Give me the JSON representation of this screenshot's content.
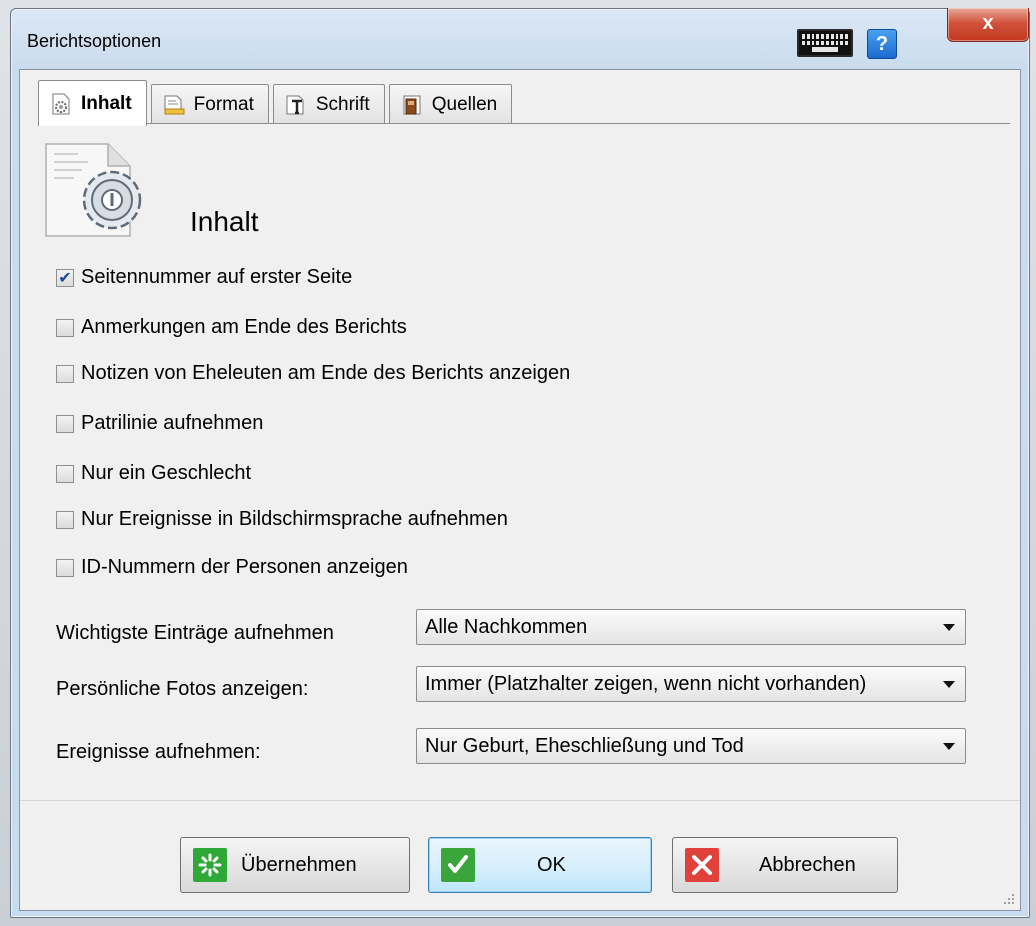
{
  "window": {
    "title": "Berichtsoptionen",
    "close_label": "x",
    "help_label": "?"
  },
  "tabs": [
    {
      "label": "Inhalt",
      "icon": "gear-page-icon",
      "active": true
    },
    {
      "label": "Format",
      "icon": "format-icon",
      "active": false
    },
    {
      "label": "Schrift",
      "icon": "font-icon",
      "active": false
    },
    {
      "label": "Quellen",
      "icon": "book-icon",
      "active": false
    }
  ],
  "panel": {
    "title": "Inhalt",
    "icon": "settings-page-icon"
  },
  "options": [
    {
      "label": "Seitennummer auf erster Seite",
      "checked": true
    },
    {
      "label": "Anmerkungen am Ende des Berichts",
      "checked": false
    },
    {
      "label": "Notizen von Eheleuten am Ende des Berichts anzeigen",
      "checked": false
    },
    {
      "label": "Patrilinie aufnehmen",
      "checked": false
    },
    {
      "label": "Nur ein Geschlecht",
      "checked": false
    },
    {
      "label": "Nur Ereignisse in Bildschirmsprache aufnehmen",
      "checked": false
    },
    {
      "label": "ID-Nummern der Personen anzeigen",
      "checked": false
    }
  ],
  "fields": [
    {
      "label": "Wichtigste Einträge aufnehmen",
      "value": "Alle Nachkommen"
    },
    {
      "label": "Persönliche Fotos anzeigen:",
      "value": "Immer (Platzhalter zeigen, wenn nicht vorhanden)"
    },
    {
      "label": "Ereignisse aufnehmen:",
      "value": "Nur Geburt, Eheschließung und Tod"
    }
  ],
  "buttons": {
    "apply": "Übernehmen",
    "ok": "OK",
    "cancel": "Abbrechen"
  },
  "colors": {
    "apply_icon": "#2ea836",
    "ok_icon": "#3aa53a",
    "cancel_icon": "#e0413a",
    "check_mark": "#1b4aa0"
  }
}
